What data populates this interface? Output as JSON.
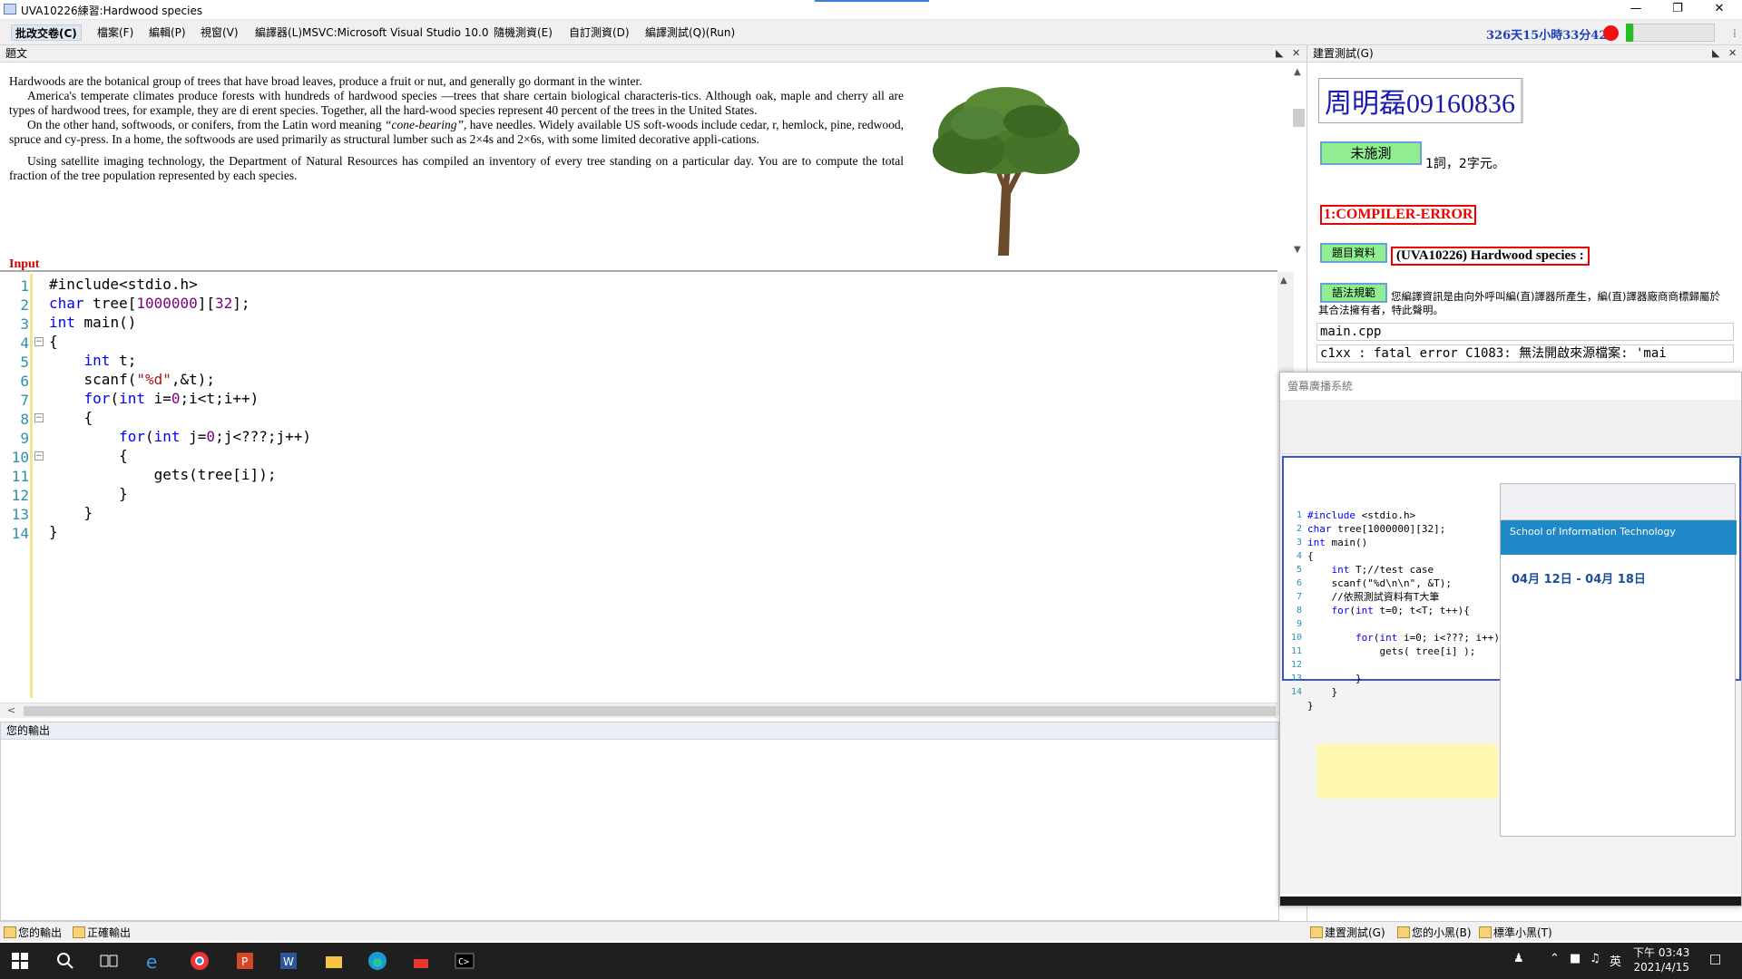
{
  "window": {
    "title": "UVA10226練習:Hardwood species"
  },
  "menu": {
    "submit": "批改交卷(C)",
    "file": "檔案(F)",
    "edit": "編輯(P)",
    "view": "視窗(V)",
    "compiler": "編譯器(L)MSVC:Microsoft Visual Studio 10.0",
    "random_test": "隨機測資(E)",
    "custom_test": "自訂測資(D)",
    "compile_run": "編譯測試(Q)(Run)"
  },
  "timer": "326天15小時33分42秒",
  "problem_panel": {
    "title": "題文",
    "paragraphs": [
      "Hardwoods are the botanical group of trees that have broad leaves, produce a fruit or nut, and generally go dormant in the winter.",
      "America's temperate climates produce forests with hundreds of hardwood species —trees that share certain biological characteris-tics. Although oak, maple and cherry all are types of hardwood trees, for example, they are di erent species. Together, all the hard-wood species represent 40 percent of the trees in the United States.",
      "On the other hand, softwoods, or conifers, from the Latin word meaning",
      "“cone-bearing”",
      ", have needles. Widely available US soft-woods include cedar, r, hemlock, pine, redwood, spruce and cy-press. In a home, the softwoods are used primarily as structural lumber such as 2×4s and 2×6s, with some limited decorative appli-cations.",
      "Using satellite imaging technology, the Department of Natural Resources has compiled an inventory of every tree standing on a particular day. You are to compute the total fraction of the tree population represented by each species."
    ],
    "input_heading": "Input"
  },
  "editor": {
    "line_numbers": [
      "1",
      "2",
      "3",
      "4",
      "5",
      "6",
      "7",
      "8",
      "9",
      "10",
      "11",
      "12",
      "13",
      "14"
    ]
  },
  "output_panel": {
    "title": "您的輸出"
  },
  "bottom_tabs": {
    "your_output": "您的輸出",
    "correct_output": "正確輸出"
  },
  "right_panel": {
    "title": "建置測試(G)",
    "student": "周明磊09160836",
    "status_button": "未施測",
    "status_text": "1詞，2字元。",
    "error": "1:COMPILER-ERROR",
    "info_button": "題目資料",
    "problem_title": "(UVA10226) Hardwood species :",
    "rules_button": "語法規範",
    "legal_text": "您編譯資訊是由向外呼叫編(直)譯器所產生，編(直)譯器廠商商標歸屬於其合法擁有者，特此聲明。",
    "file": "main.cpp",
    "error_line": "c1xx : fatal error C1083: 無法開啟來源檔案: 'mai"
  },
  "right_tabs": {
    "build": "建置測試(G)",
    "your_black": "您的小黑(B)",
    "std_black": "標準小黑(T)"
  },
  "cast_window": {
    "title": "螢幕廣播系統",
    "school": "School of Information Technology",
    "dates": "04月 12日 - 04月 18日"
  },
  "taskbar": {
    "time": "下午 03:43",
    "date": "2021/4/15"
  },
  "colors": {
    "keyword": "#0000ff",
    "string": "#a31515",
    "number": "#800080",
    "error": "#e00000",
    "green_button": "#90ee90",
    "timer": "#1f3fb8"
  }
}
